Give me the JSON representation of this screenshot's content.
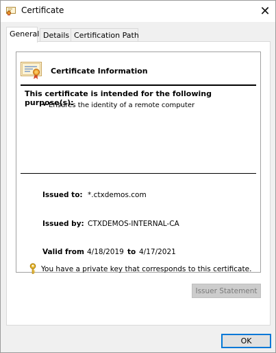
{
  "window": {
    "title": "Certificate",
    "close_glyph": "✕"
  },
  "tabs": [
    {
      "label": "General",
      "active": true
    },
    {
      "label": "Details",
      "active": false
    },
    {
      "label": "Certification Path",
      "active": false
    }
  ],
  "general": {
    "info_title": "Certificate Information",
    "purpose_heading": "This certificate is intended for the following purpose(s):",
    "purposes": [
      "• Ensures the identity of a remote computer"
    ],
    "issued_to_label": "Issued to:",
    "issued_to_value": "*.ctxdemos.com",
    "issued_by_label": "Issued by:",
    "issued_by_value": "CTXDEMOS-INTERNAL-CA",
    "valid_from_label": "Valid from",
    "valid_from_value": "4/18/2019",
    "valid_to_label": "to",
    "valid_to_value": "4/17/2021",
    "private_key_text": "You have a private key that corresponds to this certificate."
  },
  "buttons": {
    "issuer_statement": "Issuer Statement",
    "ok": "OK"
  },
  "icons": {
    "title": "certificate-icon",
    "info": "certificate-icon",
    "key": "key-icon",
    "close": "close-icon"
  },
  "colors": {
    "focus_border": "#0078d7",
    "key_gold": "#d8a419",
    "seal_orange": "#e8902a"
  }
}
